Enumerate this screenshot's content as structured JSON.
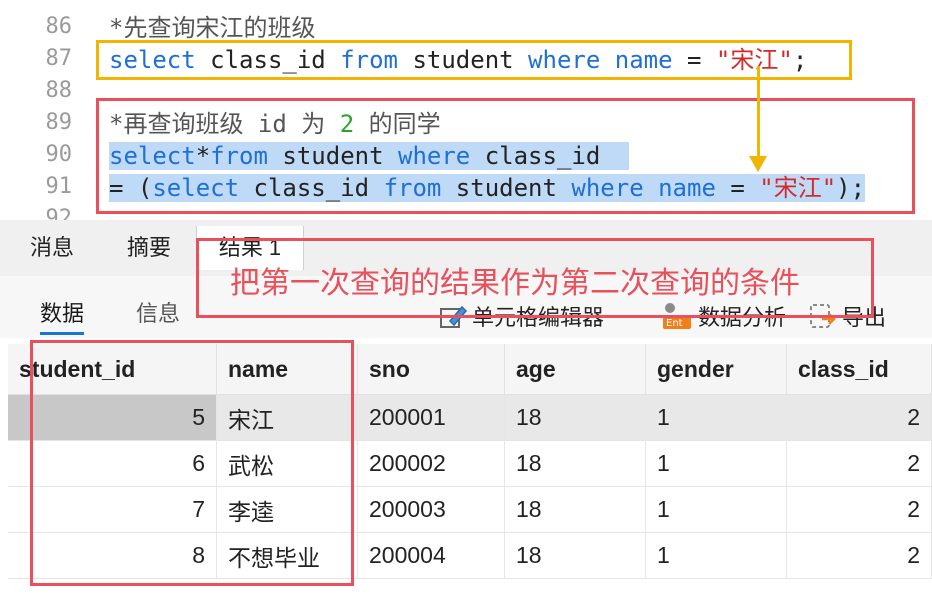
{
  "editor": {
    "lines": [
      {
        "n": "86"
      },
      {
        "n": "87"
      },
      {
        "n": "88"
      },
      {
        "n": "89"
      },
      {
        "n": "90"
      },
      {
        "n": "91"
      },
      {
        "n": "92"
      }
    ],
    "l86": "*先查询宋江的班级",
    "l87": {
      "kw1": "select",
      "t1": " class_id ",
      "kw2": "from",
      "t2": " student ",
      "kw3": "where",
      "t3": " ",
      "kw4": "name",
      "t4": " = ",
      "str": "\"宋江\"",
      "t5": ";"
    },
    "l89": {
      "t1": "*再查询班级 id 为 ",
      "num": "2",
      "t2": " 的同学"
    },
    "l90": {
      "kw1": "select",
      "t1": "*",
      "kw2": "from",
      "t2": " student ",
      "kw3": "where",
      "t3": " class_id  "
    },
    "l91": {
      "t1": "= (",
      "kw1": "select",
      "t2": " class_id ",
      "kw2": "from",
      "t3": " student ",
      "kw3": "where",
      "t4": " ",
      "kw4": "name",
      "t5": " = ",
      "str": "\"宋江\"",
      "t6": ");"
    }
  },
  "tabs": {
    "messages": "消息",
    "summary": "摘要",
    "result1": "结果 1"
  },
  "subtabs": {
    "data": "数据",
    "info": "信息"
  },
  "tools": {
    "cell_editor": "单元格编辑器",
    "data_analysis": "数据分析",
    "export": "导出"
  },
  "annotation": "把第一次查询的结果作为第二次查询的条件",
  "table": {
    "columns": [
      "student_id",
      "name",
      "sno",
      "age",
      "gender",
      "class_id"
    ],
    "rows": [
      [
        "5",
        "宋江",
        "200001",
        "18",
        "1",
        "2"
      ],
      [
        "6",
        "武松",
        "200002",
        "18",
        "1",
        "2"
      ],
      [
        "7",
        "李逵",
        "200003",
        "18",
        "1",
        "2"
      ],
      [
        "8",
        "不想毕业",
        "200004",
        "18",
        "1",
        "2"
      ]
    ]
  },
  "colors": {
    "keyword": "#1e6fd9",
    "string": "#d22b2b",
    "number": "#2aa52a",
    "highlight_red": "#e8505b",
    "highlight_yellow": "#f1b400",
    "selection": "#bfdaf7"
  }
}
